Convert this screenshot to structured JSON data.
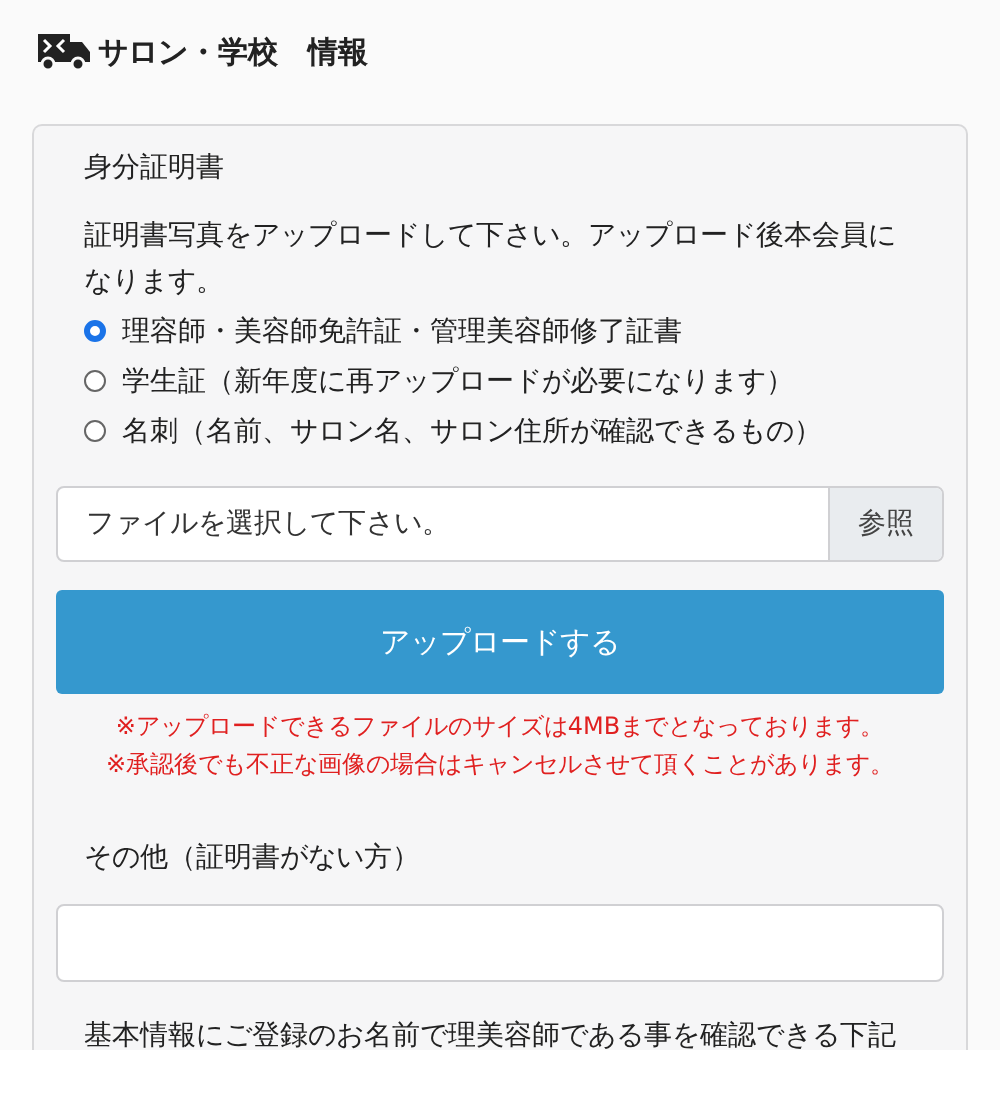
{
  "header": {
    "title": "サロン・学校　情報"
  },
  "id_section": {
    "heading": "身分証明書",
    "description": "証明書写真をアップロードして下さい。アップロード後本会員になります。",
    "options": [
      {
        "label": "理容師・美容師免許証・管理美容師修了証書",
        "selected": true
      },
      {
        "label": "学生証（新年度に再アップロードが必要になります）",
        "selected": false
      },
      {
        "label": "名刺（名前、サロン名、サロン住所が確認できるもの）",
        "selected": false
      }
    ],
    "file_field": {
      "placeholder": "ファイルを選択して下さい。",
      "browse_label": "参照"
    },
    "upload_button": "アップロードする",
    "notes": [
      "※アップロードできるファイルのサイズは4MBまでとなっております。",
      "※承認後でも不正な画像の場合はキャンセルさせて頂くことがあります。"
    ]
  },
  "other_section": {
    "heading": "その他（証明書がない方）",
    "description": "基本情報にご登録のお名前で理美容師である事を確認できる下記"
  }
}
